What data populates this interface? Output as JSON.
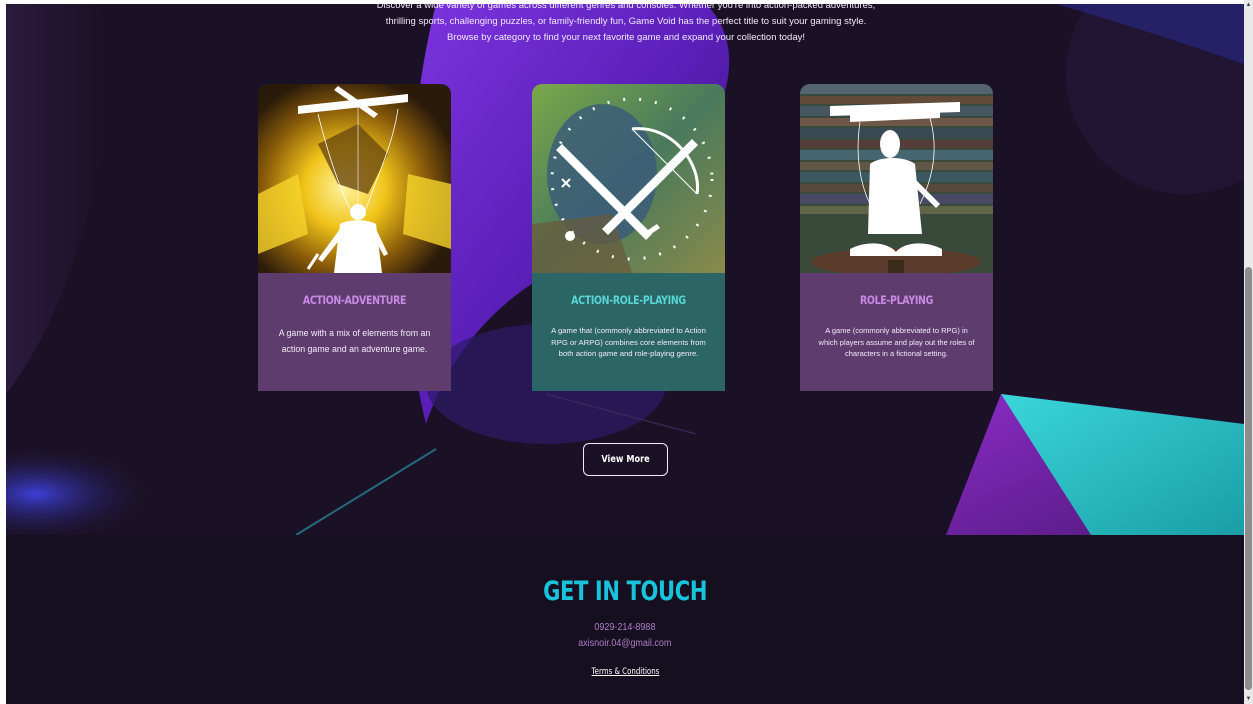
{
  "intro": {
    "line1": "Discover a wide variety of games across different genres and consoles. Whether you're into action-packed adventures,",
    "line2": "thrilling sports, challenging puzzles, or family-friendly fun, Game Void has the perfect title to suit your gaming style.",
    "line3": "Browse by category to find your next favorite game and expand your collection today!"
  },
  "categories": [
    {
      "title": "Action-Adventure",
      "description": "A game with a mix of elements from an action game and an adventure game.",
      "icon": "marionette-hero-icon"
    },
    {
      "title": "Action-Role-Playing",
      "description": "A game that (commonly abbreviated to Action RPG or ARPG) combines core elements from both action game and role-playing genre.",
      "icon": "crossbow-sword-icon"
    },
    {
      "title": "Role-Playing",
      "description": "A game (commonly abbreviated to RPG) in which players assume and play out the roles of characters in a fictional setting.",
      "icon": "marionette-reader-icon"
    }
  ],
  "view_more_label": "View More",
  "footer": {
    "title": "GET IN TOUCH",
    "phone": "0929-214-8988",
    "email": "axisnoir.04@gmail.com",
    "terms_label": "Terms & Conditions"
  },
  "colors": {
    "background": "#150f1f",
    "accent_cyan": "#19c3dc",
    "accent_purple": "#c98ae6",
    "card_purple": "#5e3c6e",
    "card_teal": "#2b6566"
  }
}
